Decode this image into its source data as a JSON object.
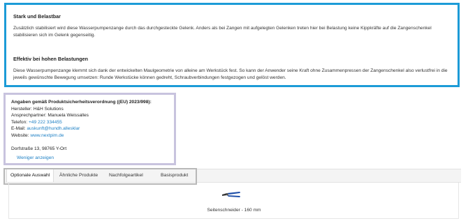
{
  "features": [
    {
      "heading": "Stark und Belastbar",
      "text": "Zusätzlich stabilisiert wird diese Wasserpumpenzange durch das durchgesteckte Gelenk. Anders als bei Zangen mit aufgelegten Gelenken treten hier bei Belastung keine Kippkräfte auf die Zangenschenkel stabilisieren sich im Gelenk gegenseitig."
    },
    {
      "heading": "Effektiv bei hohen Belastungen",
      "text": "Diese Wasserpumpenzange klemmt sich dank der entwickelten Maulgeometrie von alleine am Werkstück fest. So kann der Anwender seine Kraft ohne Zusammenpressen der Zangenschenkel also verlustfrei in die jeweils gewünschte Bewegung umsetzen: Runde Werkstücke können gedreht, Schraubverbindungen festgezogen und gelöst werden."
    }
  ],
  "safety": {
    "title": "Angaben gemäß Produktsicherheitsverordnung ((EU) 2023/998):",
    "manufacturer": "Hersteller: H&H Solutions",
    "contact": "Ansprechpartner: Manuela Weissalles",
    "phone_label": "Telefon:",
    "phone": "+49 222 334455",
    "email_label": "E-Mail:",
    "email": "auskunft@hundh.allesklar",
    "website_label": "Website:",
    "website": "www.nextpim.de",
    "address": "Dorfstraße 13, 98765 Y-Ort",
    "less_link": "Weniger anzeigen"
  },
  "tabs": [
    {
      "label": "Optionale Auswahl",
      "active": true
    },
    {
      "label": "Ähnliche Produkte",
      "active": false
    },
    {
      "label": "Nachfolgeartikel",
      "active": false
    },
    {
      "label": "Basisprodukt",
      "active": false
    }
  ],
  "product": {
    "name": "Seitenschneider - 160 mm",
    "icon": "pliers-icon",
    "colors": {
      "handle": "#1f4fa8",
      "head": "#333333"
    }
  },
  "colors": {
    "feature_border": "#1c9bd7",
    "safety_border": "#c8c3de",
    "link": "#1c7fc4",
    "tabs_outline": "#b8b8b8"
  }
}
